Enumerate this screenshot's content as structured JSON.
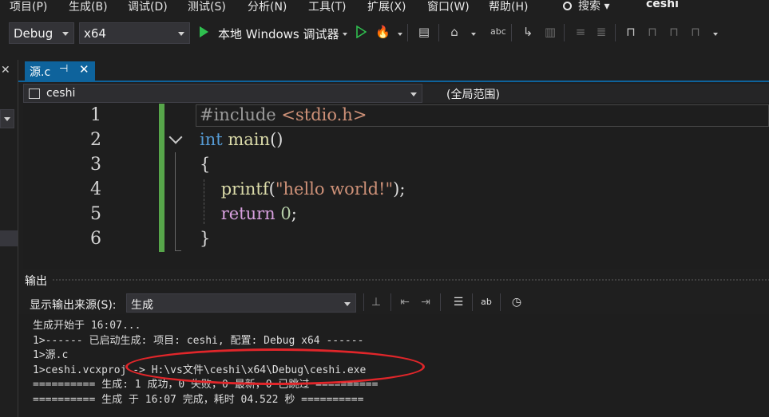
{
  "menu": {
    "items": [
      "项目(P)",
      "生成(B)",
      "调试(D)",
      "测试(S)",
      "分析(N)",
      "工具(T)",
      "扩展(X)",
      "窗口(W)",
      "帮助(H)"
    ],
    "search_label": "搜索",
    "solution_name": "ceshi"
  },
  "toolbar": {
    "config": "Debug",
    "platform": "x64",
    "run_label": "本地 Windows 调试器"
  },
  "editor": {
    "tab_label": "源.c",
    "tab_pin": "⊣",
    "tab_close": "✕",
    "nav_project": "ceshi",
    "nav_scope": "(全局范围)",
    "line_numbers": [
      "1",
      "2",
      "3",
      "4",
      "5",
      "6"
    ],
    "lines": [
      [
        {
          "t": "#include ",
          "c": "pre"
        },
        {
          "t": "<stdio.h>",
          "c": "str"
        }
      ],
      [
        {
          "t": "int",
          "c": "kw"
        },
        {
          "t": " ",
          "c": ""
        },
        {
          "t": "main",
          "c": "fn"
        },
        {
          "t": "()",
          "c": ""
        }
      ],
      [
        {
          "t": "{",
          "c": ""
        }
      ],
      [
        {
          "t": "    ",
          "c": ""
        },
        {
          "t": "printf",
          "c": "fn"
        },
        {
          "t": "(",
          "c": ""
        },
        {
          "t": "\"hello world!\"",
          "c": "str"
        },
        {
          "t": ");",
          "c": ""
        }
      ],
      [
        {
          "t": "    ",
          "c": ""
        },
        {
          "t": "return",
          "c": "ctl"
        },
        {
          "t": " ",
          "c": ""
        },
        {
          "t": "0",
          "c": "num"
        },
        {
          "t": ";",
          "c": ""
        }
      ],
      [
        {
          "t": "}",
          "c": ""
        }
      ]
    ]
  },
  "output": {
    "title": "输出",
    "source_label": "显示输出来源(S):",
    "source_value": "生成",
    "lines": [
      "生成开始于 16:07...",
      "1>------ 已启动生成: 项目: ceshi, 配置: Debug x64 ------",
      "1>源.c",
      "1>ceshi.vcxproj -> H:\\vs文件\\ceshi\\x64\\Debug\\ceshi.exe",
      "========== 生成: 1 成功，0 失败，0 最新，0 已跳过 ==========",
      "========== 生成 于 16:07 完成，耗时 04.522 秒 =========="
    ]
  },
  "colors": {
    "accent": "#0e639c",
    "change_bar": "#57a64a",
    "annotation": "#e0262a"
  }
}
